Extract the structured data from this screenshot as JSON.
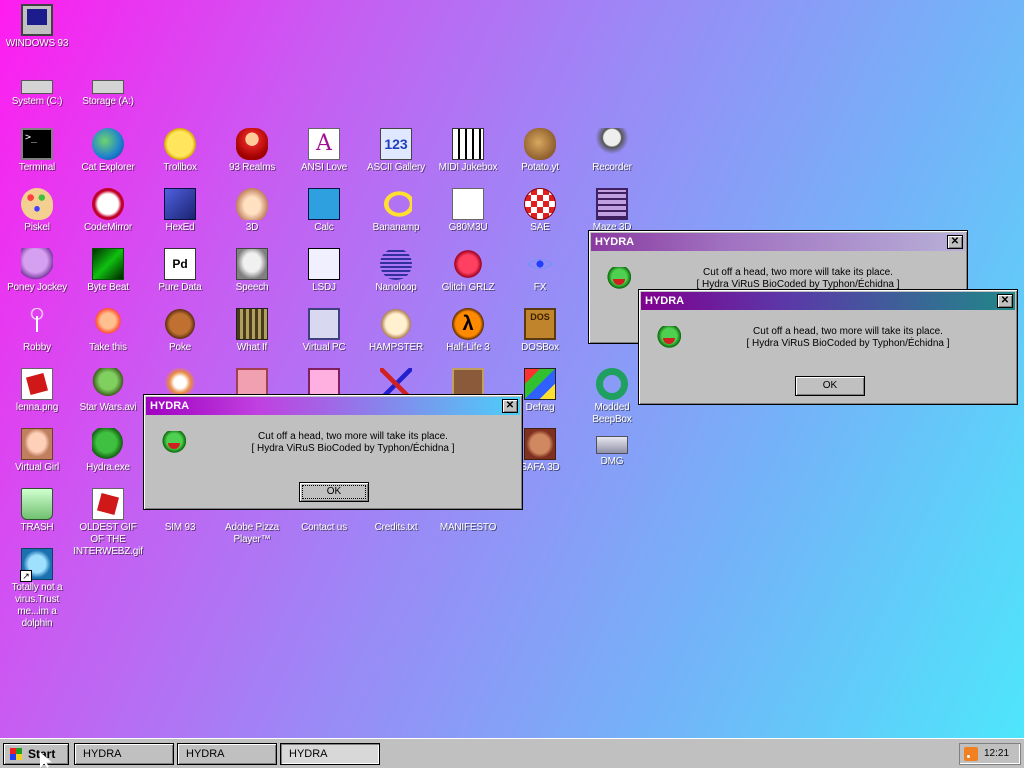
{
  "desktop": {
    "icons": [
      {
        "label": "WINDOWS 93",
        "icon": "monitor-icon"
      },
      {
        "label": "System (C:)",
        "icon": "drive-icon"
      },
      {
        "label": "Storage (A:)",
        "icon": "floppy-icon"
      },
      {
        "label": "Terminal",
        "icon": "terminal-icon"
      },
      {
        "label": "Cat Explorer",
        "icon": "globe-icon"
      },
      {
        "label": "Trollbox",
        "icon": "troll-face-icon"
      },
      {
        "label": "93 Realms",
        "icon": "mario-icon"
      },
      {
        "label": "ANSI Love",
        "icon": "ansi-icon"
      },
      {
        "label": "ASCII Gallery",
        "icon": "ascii-123-icon"
      },
      {
        "label": "MIDI Jukebox",
        "icon": "piano-icon"
      },
      {
        "label": "Potato.yt",
        "icon": "potato-icon"
      },
      {
        "label": "Recorder",
        "icon": "microphone-icon"
      },
      {
        "label": "Piskel",
        "icon": "palette-icon"
      },
      {
        "label": "CodeMirror",
        "icon": "codemirror-icon"
      },
      {
        "label": "HexEd",
        "icon": "hex-cube-icon"
      },
      {
        "label": "3D",
        "icon": "teapot-icon"
      },
      {
        "label": "Calc",
        "icon": "calculator-icon"
      },
      {
        "label": "Bananamp",
        "icon": "banana-icon"
      },
      {
        "label": "G80M3U",
        "icon": "playlist-doc-icon"
      },
      {
        "label": "SAE",
        "icon": "amiga-ball-icon"
      },
      {
        "label": "Maze 3D",
        "icon": "maze-icon"
      },
      {
        "label": "Poney Jockey",
        "icon": "pony-icon"
      },
      {
        "label": "Byte Beat",
        "icon": "bytebeat-icon"
      },
      {
        "label": "Pure Data",
        "icon": "pure-data-icon"
      },
      {
        "label": "Speech",
        "icon": "speech-face-icon"
      },
      {
        "label": "LSDJ",
        "icon": "lsdj-icon"
      },
      {
        "label": "Nanoloop",
        "icon": "nanoloop-icon"
      },
      {
        "label": "Glitch GRLZ",
        "icon": "lips-icon"
      },
      {
        "label": "FX",
        "icon": "atom-icon"
      },
      {
        "label": "Robby",
        "icon": "stick-figure-icon"
      },
      {
        "label": "Take this",
        "icon": "take-this-icon"
      },
      {
        "label": "Poke",
        "icon": "pokemon-icon"
      },
      {
        "label": "What If",
        "icon": "what-if-icon"
      },
      {
        "label": "Virtual PC",
        "icon": "virtual-pc-icon"
      },
      {
        "label": "HAMPSTER",
        "icon": "hamster-icon"
      },
      {
        "label": "Half-Life 3",
        "icon": "half-life-icon"
      },
      {
        "label": "DOSBox",
        "icon": "dosbox-icon"
      },
      {
        "label": "lenna.png",
        "icon": "image-file-icon"
      },
      {
        "label": "Star Wars.avi",
        "icon": "yoda-icon"
      },
      {
        "label": "",
        "icon": "corgi-icon"
      },
      {
        "label": "",
        "icon": "robot-icon"
      },
      {
        "label": "",
        "icon": "face-icon"
      },
      {
        "label": "",
        "icon": "crossed-swords-icon"
      },
      {
        "label": "",
        "icon": "painting-icon"
      },
      {
        "label": "Defrag",
        "icon": "defrag-icon"
      },
      {
        "label": "Modded BeepBox",
        "icon": "beepbox-ring-icon"
      },
      {
        "label": "Virtual Girl",
        "icon": "virtual-girl-icon"
      },
      {
        "label": "Hydra.exe",
        "icon": "hydra-icon"
      },
      {
        "label": "SAFA 3D",
        "icon": "doom-face-icon"
      },
      {
        "label": "DMG",
        "icon": "dmg-icon"
      },
      {
        "label": "TRASH",
        "icon": "trash-icon"
      },
      {
        "label": "OLDEST GIF OF THE INTERWEBZ.gif",
        "icon": "gif-file-icon"
      },
      {
        "label": "SIM 93",
        "icon": "sim-icon"
      },
      {
        "label": "Adobe Pizza Player™",
        "icon": "pizza-icon"
      },
      {
        "label": "Contact us",
        "icon": "contact-icon"
      },
      {
        "label": "Credits.txt",
        "icon": "text-file-icon"
      },
      {
        "label": "MANIFESTO",
        "icon": "manifesto-icon"
      },
      {
        "label": "Totally not a virus.Trust me...im a dolphin",
        "icon": "dolphin-icon"
      }
    ]
  },
  "dialogs": [
    {
      "title": "HYDRA",
      "message_line1": "Cut off a head, two more will take its place.",
      "message_line2": "[ Hydra ViRuS BioCoded by Typhon/Échidna ]",
      "ok_label": "OK",
      "close_label": "✕"
    },
    {
      "title": "HYDRA",
      "message_line1": "Cut off a head, two more will take its place.",
      "message_line2": "[ Hydra ViRuS BioCoded by Typhon/Échidna ]",
      "ok_label": "OK",
      "close_label": "✕"
    },
    {
      "title": "HYDRA",
      "message_line1": "Cut off a head, two more will take its place.",
      "message_line2": "[ Hydra ViRuS BioCoded by Typhon/Échidna ]",
      "ok_label": "OK",
      "close_label": "✕"
    }
  ],
  "taskbar": {
    "start_label": "Start",
    "tasks": [
      {
        "label": "HYDRA"
      },
      {
        "label": "HYDRA"
      },
      {
        "label": "HYDRA"
      }
    ],
    "clock": "12:21",
    "tray_icon": "rss-icon"
  },
  "colors": {
    "desktop_gradient": [
      "#ff1cf0",
      "#9a8af6",
      "#4ee6fb"
    ],
    "window_face": "#c0c0c0",
    "title_active": "#a000c0"
  }
}
